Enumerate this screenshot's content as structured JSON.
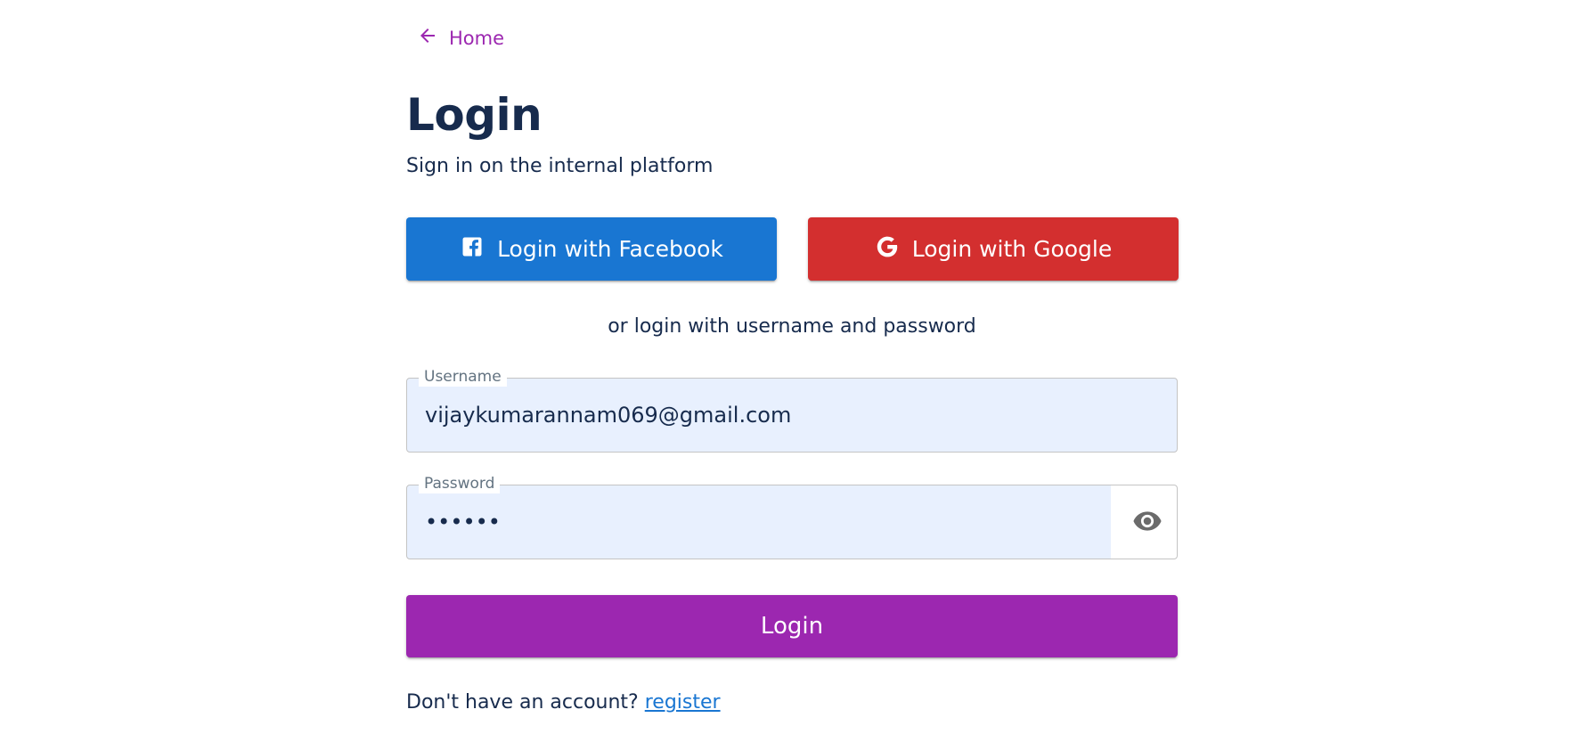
{
  "nav": {
    "home_label": "Home"
  },
  "header": {
    "title": "Login",
    "subtitle": "Sign in on the internal platform"
  },
  "social": {
    "facebook_label": "Login with Facebook",
    "google_label": "Login with Google"
  },
  "divider": {
    "text": "or login with username and password"
  },
  "form": {
    "username": {
      "label": "Username",
      "value": "vijaykumarannam069@gmail.com"
    },
    "password": {
      "label": "Password",
      "value": "••••••"
    },
    "submit_label": "Login"
  },
  "footer": {
    "prompt": "Don't have an account?",
    "register_label": "register"
  },
  "colors": {
    "primary": "#9c27b0",
    "facebook": "#1976d2",
    "google": "#d32f2f",
    "autofill": "#e8f0fe"
  },
  "icons": {
    "back": "arrow-left-icon",
    "facebook": "facebook-icon",
    "google": "google-icon",
    "visibility": "eye-icon"
  }
}
